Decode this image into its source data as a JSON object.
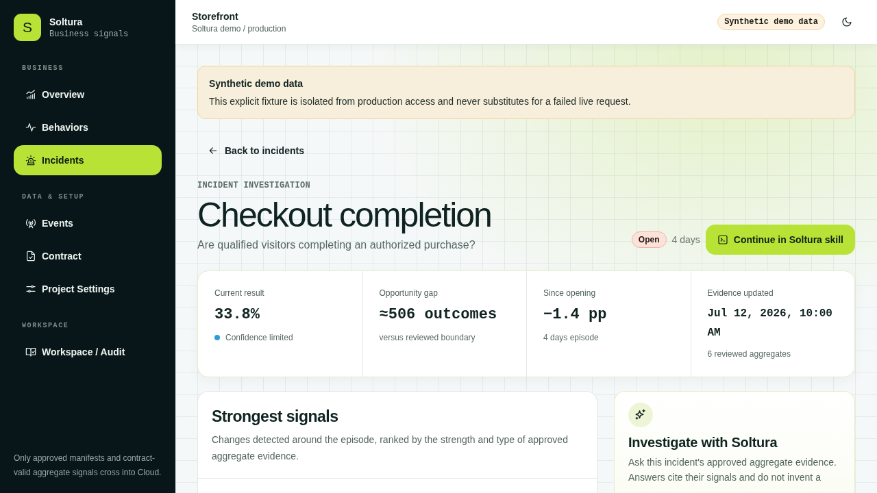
{
  "sidebar": {
    "brand": {
      "initial": "S",
      "name": "Soltura",
      "tagline": "Business signals"
    },
    "sections": [
      {
        "label": "BUSINESS",
        "items": [
          {
            "label": "Overview",
            "selected": false
          },
          {
            "label": "Behaviors",
            "selected": false
          },
          {
            "label": "Incidents",
            "selected": true
          }
        ]
      },
      {
        "label": "DATA & SETUP",
        "items": [
          {
            "label": "Events",
            "selected": false
          },
          {
            "label": "Contract",
            "selected": false
          },
          {
            "label": "Project Settings",
            "selected": false
          }
        ]
      },
      {
        "label": "WORKSPACE",
        "items": [
          {
            "label": "Workspace / Audit",
            "selected": false
          }
        ]
      }
    ],
    "footer": "Only approved manifests and contract-valid aggregate signals cross into Cloud."
  },
  "header": {
    "title": "Storefront",
    "subtitle": "Soltura demo / production",
    "badge": "Synthetic demo data"
  },
  "notice": {
    "title": "Synthetic demo data",
    "body": "This explicit fixture is isolated from production access and never substitutes for a failed live request."
  },
  "back_link": "Back to incidents",
  "incident": {
    "eyebrow": "INCIDENT INVESTIGATION",
    "title": "Checkout completion",
    "question": "Are qualified visitors completing an authorized purchase?",
    "status": "Open",
    "age": "4 days",
    "action": "Continue in Soltura skill"
  },
  "metrics": [
    {
      "kind": "figure",
      "label": "Current result",
      "value": "33.8%",
      "note": "Confidence limited",
      "color": "#2d9cdb"
    },
    {
      "kind": "figure",
      "label": "Opportunity gap",
      "value": "≈506 outcomes",
      "note": "versus reviewed boundary"
    },
    {
      "kind": "figure",
      "label": "Since opening",
      "value": "−1.4 pp",
      "note": "4 days episode"
    },
    {
      "kind": "timestamp",
      "label": "Evidence updated",
      "value": "Jul 12, 2026, 10:00 AM",
      "note": "6 reviewed aggregates"
    }
  ],
  "signals_card": {
    "title": "Strongest signals",
    "description": "Changes detected around the episode, ranked by the strength and type of approved aggregate evidence."
  },
  "assistant_card": {
    "title": "Investigate with Soltura",
    "description": "Ask this incident's approved aggregate evidence. Answers cite their signals and do not invent a"
  }
}
